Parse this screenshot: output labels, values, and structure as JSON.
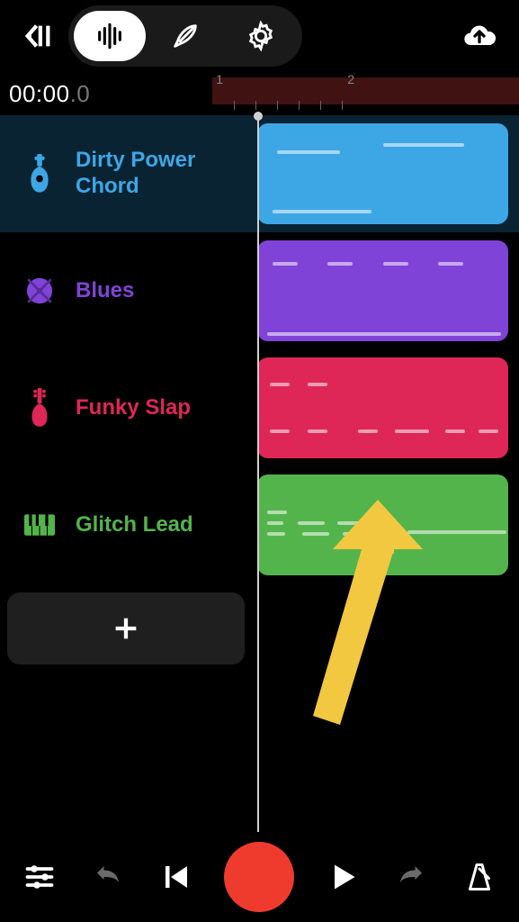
{
  "time": {
    "display": "00:00",
    "fraction": ".0"
  },
  "ruler": {
    "labels": [
      "1",
      "2"
    ]
  },
  "tracks": [
    {
      "name": "Dirty Power Chord",
      "color": "#3da7e6",
      "iconColor": "#3da7e6",
      "icon": "guitar",
      "selected": true
    },
    {
      "name": "Blues",
      "color": "#8043d7",
      "iconColor": "#8043d7",
      "icon": "drum",
      "selected": false
    },
    {
      "name": "Funky Slap",
      "color": "#de2756",
      "iconColor": "#de2756",
      "icon": "bass",
      "selected": false
    },
    {
      "name": "Glitch Lead",
      "color": "#54b44c",
      "iconColor": "#54b44c",
      "icon": "keys",
      "selected": false
    }
  ],
  "colors": {
    "record": "#ef3b2d",
    "arrow": "#f2c841"
  }
}
